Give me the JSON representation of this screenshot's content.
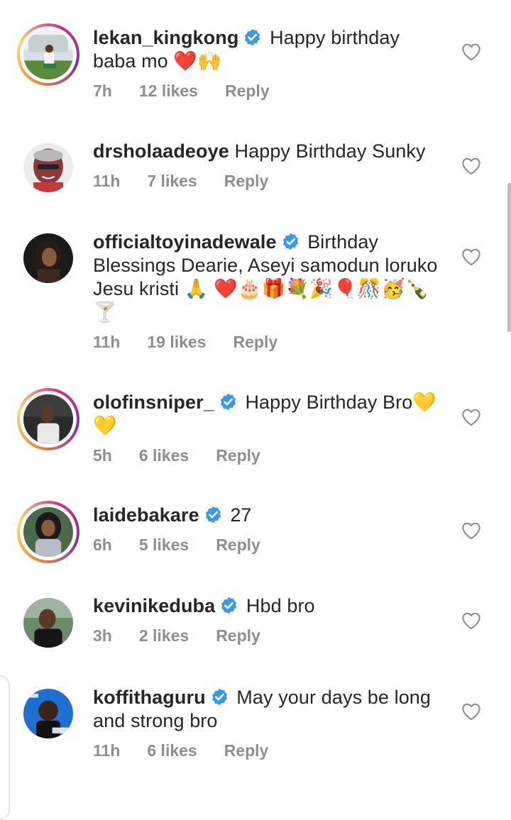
{
  "comments": [
    {
      "username": "lekan_kingkong",
      "verified": true,
      "text": "Happy birthday baba mo ❤️🙌",
      "time": "7h",
      "likes": "12 likes",
      "reply": "Reply",
      "story_ring": true
    },
    {
      "username": "drsholaadeoye",
      "verified": false,
      "text": "Happy Birthday Sunky",
      "time": "11h",
      "likes": "7 likes",
      "reply": "Reply",
      "story_ring": false
    },
    {
      "username": "officialtoyinadewale",
      "verified": true,
      "text": "Birthday Blessings Dearie, Aseyi samodun loruko Jesu kristi 🙏 ❤️🎂🎁💐🎉🎈🎊🥳🍾🍸",
      "time": "11h",
      "likes": "19 likes",
      "reply": "Reply",
      "story_ring": false
    },
    {
      "username": "olofinsniper_",
      "verified": true,
      "text": "Happy Birthday Bro💛💛",
      "time": "5h",
      "likes": "6 likes",
      "reply": "Reply",
      "story_ring": true
    },
    {
      "username": "laidebakare",
      "verified": true,
      "text": "27",
      "time": "6h",
      "likes": "5 likes",
      "reply": "Reply",
      "story_ring": true
    },
    {
      "username": "kevinikeduba",
      "verified": true,
      "text": "Hbd bro",
      "time": "3h",
      "likes": "2 likes",
      "reply": "Reply",
      "story_ring": false
    },
    {
      "username": "koffithaguru",
      "verified": true,
      "text": "May your days be long and strong bro",
      "time": "11h",
      "likes": "6 likes",
      "reply": "Reply",
      "story_ring": false
    }
  ],
  "icons": {
    "verified": "verified-badge-icon",
    "like": "heart-outline-icon"
  },
  "colors": {
    "verified_blue": "#3897f0",
    "meta_gray": "#8e8e8e",
    "text": "#262626"
  }
}
